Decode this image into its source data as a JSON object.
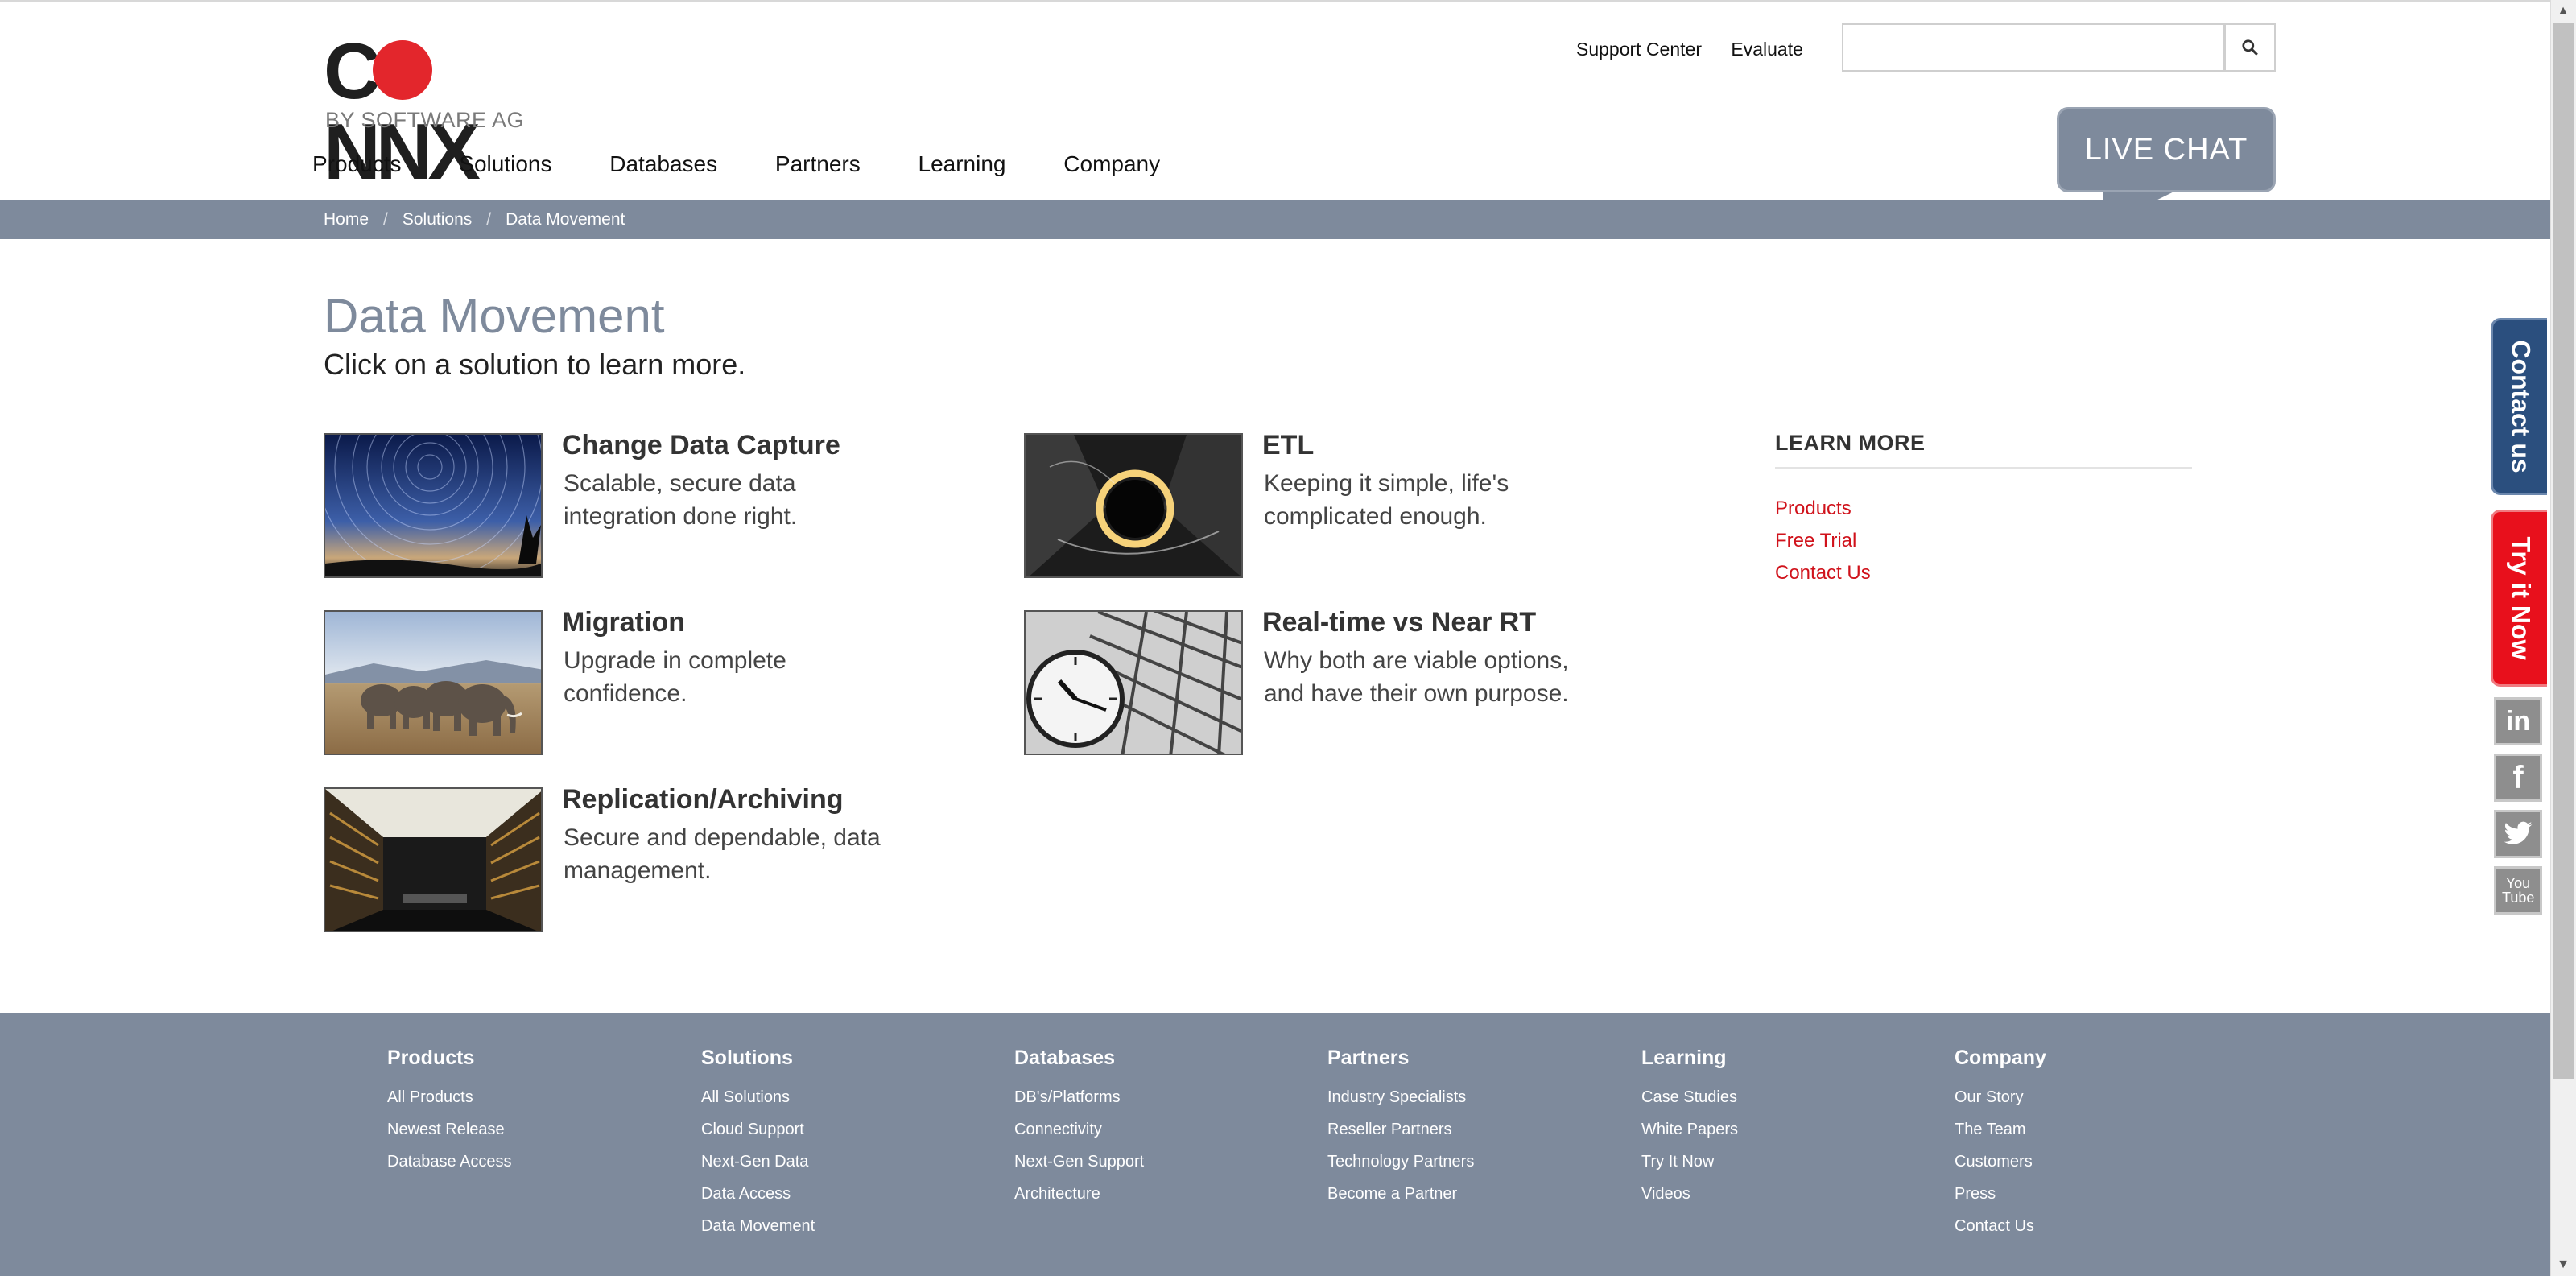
{
  "brand": {
    "logo_main": "CONNX",
    "logo_sub": "BY SOFTWARE AG"
  },
  "header": {
    "support_label": "Support Center",
    "evaluate_label": "Evaluate",
    "search_value": "",
    "live_chat_label": "LIVE CHAT"
  },
  "nav": {
    "items": [
      "Products",
      "Solutions",
      "Databases",
      "Partners",
      "Learning",
      "Company"
    ]
  },
  "breadcrumb": [
    "Home",
    "Solutions",
    "Data Movement"
  ],
  "page": {
    "title": "Data Movement",
    "subtitle": "Click on a solution to learn more."
  },
  "solutions": [
    {
      "title": "Change Data Capture",
      "desc": "Scalable, secure data integration done right.",
      "image_icon": "star-trails-image"
    },
    {
      "title": "ETL",
      "desc": "Keeping it simple, life's complicated enough.",
      "image_icon": "light-ring-image"
    },
    {
      "title": "Migration",
      "desc": "Upgrade in complete confidence.",
      "image_icon": "elephants-image"
    },
    {
      "title": "Real-time vs Near RT",
      "desc": "Why both are viable options, and have their own purpose.",
      "image_icon": "station-clock-image"
    },
    {
      "title": "Replication/Archiving",
      "desc": "Secure and dependable, data management.",
      "image_icon": "library-image"
    }
  ],
  "learn_more": {
    "title": "LEARN MORE",
    "links": [
      "Products",
      "Free Trial",
      "Contact Us"
    ]
  },
  "side_tabs": {
    "contact": "Contact us",
    "try": "Try it Now"
  },
  "social": [
    "in",
    "f",
    "twitter-bird",
    "You Tube"
  ],
  "footer": {
    "columns": [
      {
        "heading": "Products",
        "links": [
          "All Products",
          "Newest Release",
          "Database Access"
        ]
      },
      {
        "heading": "Solutions",
        "links": [
          "All Solutions",
          "Cloud Support",
          "Next-Gen Data",
          "Data Access",
          "Data Movement"
        ]
      },
      {
        "heading": "Databases",
        "links": [
          "DB's/Platforms",
          "Connectivity",
          "Next-Gen Support",
          "Architecture"
        ]
      },
      {
        "heading": "Partners",
        "links": [
          "Industry Specialists",
          "Reseller Partners",
          "Technology Partners",
          "Become a Partner"
        ]
      },
      {
        "heading": "Learning",
        "links": [
          "Case Studies",
          "White Papers",
          "Try It Now",
          "Videos"
        ]
      },
      {
        "heading": "Company",
        "links": [
          "Our Story",
          "The Team",
          "Customers",
          "Press",
          "Contact Us"
        ]
      }
    ]
  },
  "colors": {
    "brand_red": "#e3262c",
    "slate": "#7e8a9c",
    "link_red": "#d0121b",
    "contact_blue": "#2b4f7e",
    "try_red": "#e8101c"
  }
}
